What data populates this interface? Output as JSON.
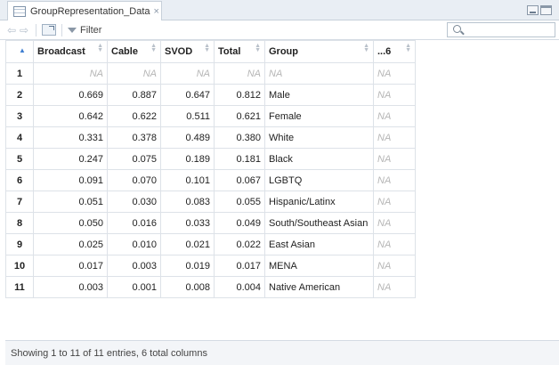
{
  "tab": {
    "title": "GroupRepresentation_Data",
    "close_glyph": "×"
  },
  "toolbar": {
    "filter_label": "Filter",
    "search": {
      "placeholder": "",
      "value": ""
    }
  },
  "table": {
    "columns": [
      "",
      "Broadcast",
      "Cable",
      "SVOD",
      "Total",
      "Group",
      "...6"
    ],
    "rows": [
      [
        "1",
        "NA",
        "NA",
        "NA",
        "NA",
        "NA",
        "NA"
      ],
      [
        "2",
        "0.669",
        "0.887",
        "0.647",
        "0.812",
        "Male",
        "NA"
      ],
      [
        "3",
        "0.642",
        "0.622",
        "0.511",
        "0.621",
        "Female",
        "NA"
      ],
      [
        "4",
        "0.331",
        "0.378",
        "0.489",
        "0.380",
        "White",
        "NA"
      ],
      [
        "5",
        "0.247",
        "0.075",
        "0.189",
        "0.181",
        "Black",
        "NA"
      ],
      [
        "6",
        "0.091",
        "0.070",
        "0.101",
        "0.067",
        "LGBTQ",
        "NA"
      ],
      [
        "7",
        "0.051",
        "0.030",
        "0.083",
        "0.055",
        "Hispanic/Latinx",
        "NA"
      ],
      [
        "8",
        "0.050",
        "0.016",
        "0.033",
        "0.049",
        "South/Southeast Asian",
        "NA"
      ],
      [
        "9",
        "0.025",
        "0.010",
        "0.021",
        "0.022",
        "East Asian",
        "NA"
      ],
      [
        "10",
        "0.017",
        "0.003",
        "0.019",
        "0.017",
        "MENA",
        "NA"
      ],
      [
        "11",
        "0.003",
        "0.001",
        "0.008",
        "0.004",
        "Native American",
        "NA"
      ]
    ]
  },
  "status": {
    "text": "Showing 1 to 11 of 11 entries, 6 total columns"
  },
  "icons": {
    "tab": "table-icon",
    "back": "back-arrow-icon",
    "forward": "forward-arrow-icon",
    "popout": "popout-window-icon",
    "filter": "filter-icon",
    "search": "search-icon",
    "minimize": "minimize-icon",
    "maximize": "maximize-icon"
  },
  "colors": {
    "sort_active": "#3f7fd1",
    "na_text": "#b5b5b5",
    "tabbar_bg": "#e9eef4"
  }
}
